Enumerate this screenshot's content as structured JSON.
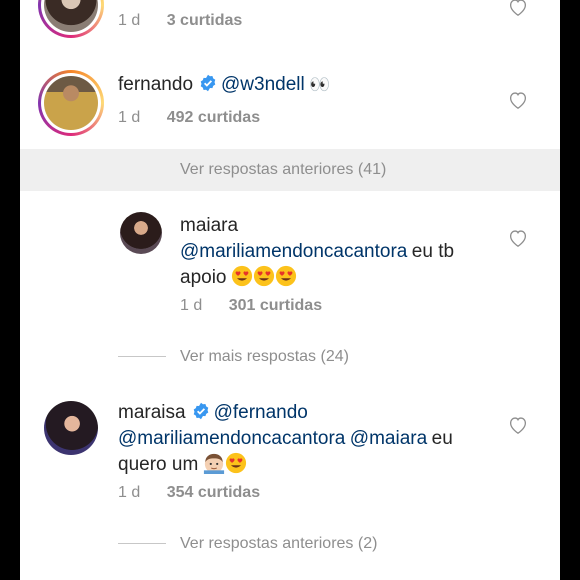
{
  "comments": [
    {
      "time": "1 d",
      "likes": "3 curtidas"
    },
    {
      "user": "fernando",
      "verified": true,
      "text_mention": "@w3ndell",
      "emoji": "👀",
      "time": "1 d",
      "likes": "492 curtidas"
    },
    {
      "user": "maiara",
      "mention": "@mariliamendoncacantora",
      "text_line1": "eu tb",
      "text_line2": "apoio",
      "emoji": "😍😍😍",
      "time": "1 d",
      "likes": "301 curtidas"
    },
    {
      "user": "maraisa",
      "verified": true,
      "mention1": "@fernando",
      "mention2": "@mariliamendoncacantora",
      "mention3": "@maiara",
      "text_after": "eu",
      "text_line3": "quero um",
      "time": "1 d",
      "likes": "354 curtidas"
    }
  ],
  "replies": {
    "previous_41": "Ver respostas anteriores (41)",
    "more_24": "Ver mais respostas (24)",
    "previous_2": "Ver respostas anteriores (2)"
  },
  "colors": {
    "mention": "#003569",
    "meta": "#8e8e8e",
    "verified": "#3897f0",
    "highlight": "#efefef"
  }
}
